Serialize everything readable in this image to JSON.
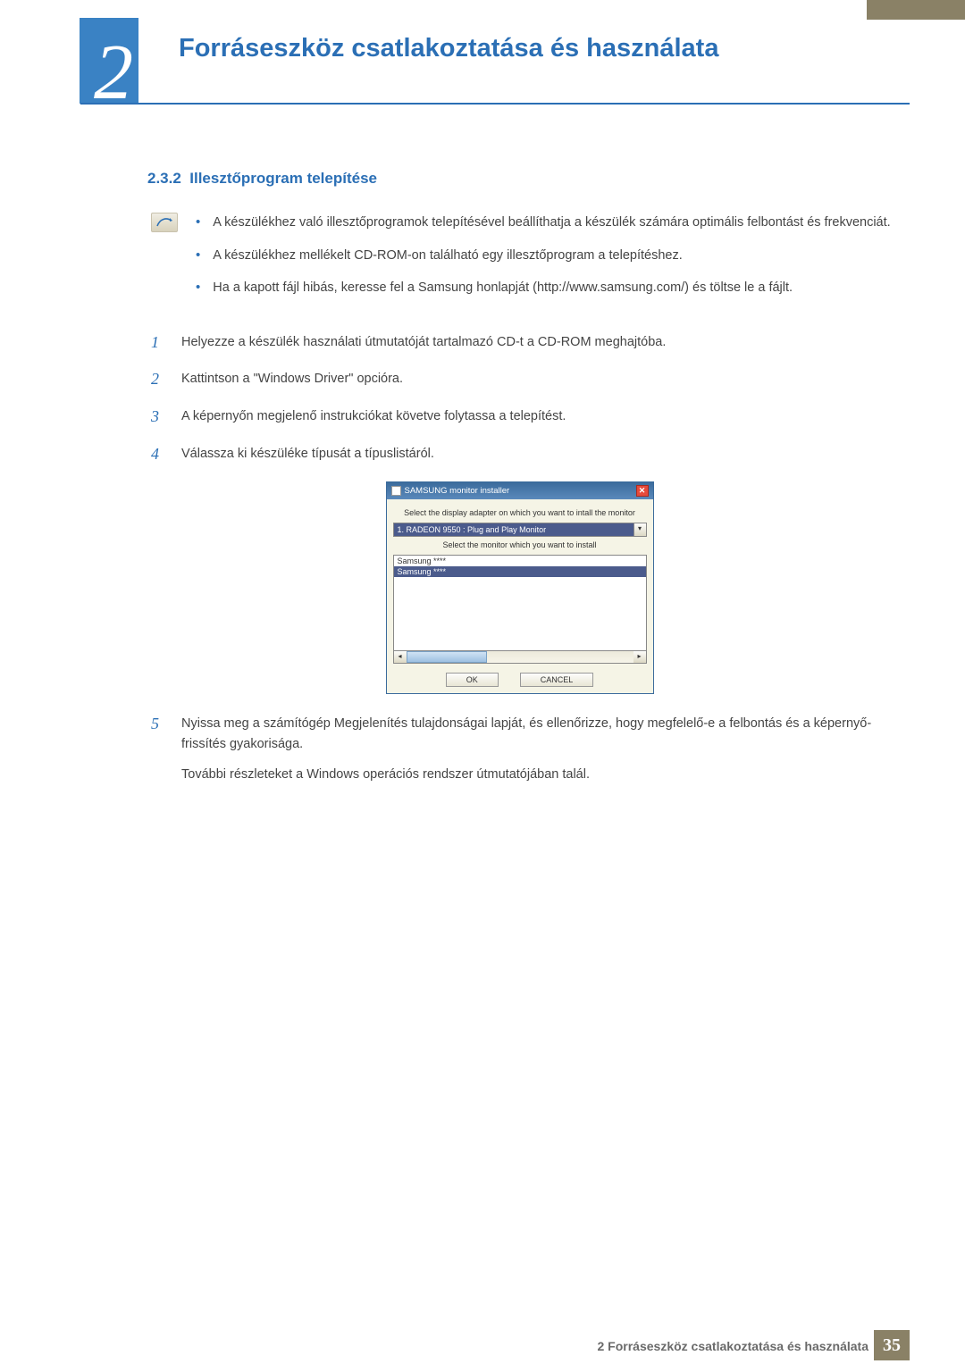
{
  "header": {
    "chapter_number": "2",
    "chapter_title": "Forráseszköz csatlakoztatása és használata"
  },
  "section": {
    "number": "2.3.2",
    "title": "Illesztőprogram telepítése"
  },
  "notes": [
    "A készülékhez való illesztőprogramok telepítésével beállíthatja a készülék számára optimális felbontást és frekvenciát.",
    "A készülékhez mellékelt CD-ROM-on található egy illesztőprogram a telepítéshez.",
    "Ha a kapott fájl hibás, keresse fel a Samsung honlapját (http://www.samsung.com/) és töltse le a fájlt."
  ],
  "steps": {
    "s1": "Helyezze a készülék használati útmutatóját tartalmazó CD-t a CD-ROM meghajtóba.",
    "s2": "Kattintson a \"Windows Driver\" opcióra.",
    "s3": "A képernyőn megjelenő instrukciókat követve folytassa a telepítést.",
    "s4": "Válassza ki készüléke típusát a típuslistáról.",
    "s5a": "Nyissa meg a számítógép Megjelenítés tulajdonságai lapját, és ellenőrizze, hogy megfelelő-e a felbontás és a képernyő-frissítés gyakorisága.",
    "s5b": "További részleteket a Windows operációs rendszer útmutatójában talál."
  },
  "step_labels": {
    "n1": "1",
    "n2": "2",
    "n3": "3",
    "n4": "4",
    "n5": "5"
  },
  "installer": {
    "title": "SAMSUNG monitor installer",
    "instr1": "Select the display adapter on which you want to intall the monitor",
    "adapter": "1. RADEON 9550 : Plug and Play Monitor",
    "instr2": "Select the monitor which you want to install",
    "monitors": {
      "m0": "Samsung ****",
      "m1": "Samsung ****"
    },
    "ok": "OK",
    "cancel": "CANCEL"
  },
  "footer": {
    "text": "2 Forráseszköz csatlakoztatása és használata",
    "page": "35"
  }
}
